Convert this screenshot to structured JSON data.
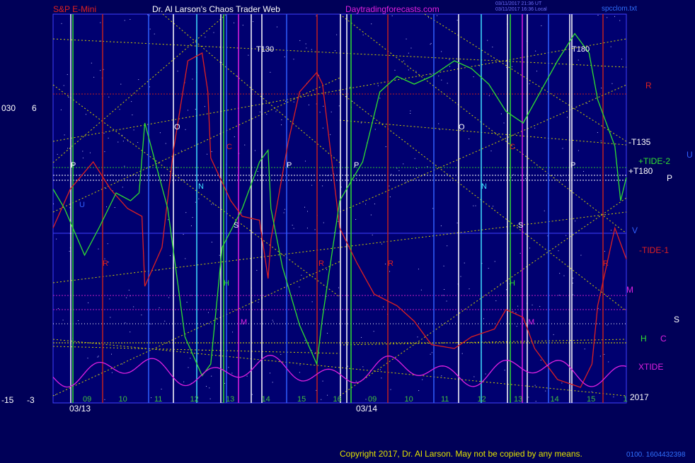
{
  "header": {
    "instrument": "S&P E-Mini",
    "author": "Dr. Al Larson's Chaos Trader Web",
    "site": "Daytradingforecasts.com",
    "timestamp_line1": "03/11/2017 21:36 UT",
    "timestamp_line2": "03/11/2017 16:36 Local",
    "file": "spcclom.txt"
  },
  "footer": {
    "copyright": "Copyright 2017, Dr. Al Larson. May not be copied by any means.",
    "code": "0100. 1604432398"
  },
  "left_axis": {
    "top": [
      "030",
      "6"
    ],
    "bottom": [
      "-15",
      "-3"
    ]
  },
  "right_labels": [
    {
      "text": "R",
      "color": "#e02020"
    },
    {
      "text": "-T135",
      "color": "#ffffff"
    },
    {
      "text": "+TIDE-2",
      "color": "#30e030"
    },
    {
      "text": "U",
      "color": "#3060ff"
    },
    {
      "text": "+T180",
      "color": "#ffffff"
    },
    {
      "text": "P",
      "color": "#ffffff"
    },
    {
      "text": "V",
      "color": "#3060ff"
    },
    {
      "text": "-TIDE-1",
      "color": "#e02020"
    },
    {
      "text": "M",
      "color": "#e020e0"
    },
    {
      "text": "S",
      "color": "#ffffff"
    },
    {
      "text": "H",
      "color": "#30e030"
    },
    {
      "text": "C",
      "color": "#e020e0"
    },
    {
      "text": "XTIDE",
      "color": "#e020e0"
    },
    {
      "text": "2017",
      "color": "#ffffff"
    }
  ],
  "chart_data": {
    "type": "line",
    "dates": [
      "03/13",
      "03/14"
    ],
    "x_ticks": [
      [
        "09",
        "10",
        "11",
        "12",
        "13",
        "14",
        "15",
        "16"
      ],
      [
        "09",
        "10",
        "11",
        "12",
        "13",
        "14",
        "15",
        "1"
      ]
    ],
    "series": [
      {
        "name": "TIDE-1",
        "color": "#e02020"
      },
      {
        "name": "TIDE-2",
        "color": "#30e030"
      },
      {
        "name": "XTIDE",
        "color": "#e020e0"
      }
    ],
    "series_values": {
      "red": [
        [
          0,
          0.55
        ],
        [
          0.03,
          0.45
        ],
        [
          0.07,
          0.38
        ],
        [
          0.1,
          0.45
        ],
        [
          0.13,
          0.5
        ],
        [
          0.155,
          0.52
        ],
        [
          0.16,
          0.7
        ],
        [
          0.19,
          0.6
        ],
        [
          0.21,
          0.35
        ],
        [
          0.235,
          0.12
        ],
        [
          0.26,
          0.1
        ],
        [
          0.27,
          0.2
        ],
        [
          0.275,
          0.37
        ],
        [
          0.31,
          0.48
        ],
        [
          0.33,
          0.52
        ],
        [
          0.36,
          0.53
        ],
        [
          0.375,
          0.68
        ],
        [
          0.38,
          0.58
        ],
        [
          0.41,
          0.33
        ],
        [
          0.43,
          0.2
        ],
        [
          0.46,
          0.15
        ],
        [
          0.47,
          0.18
        ],
        [
          0.5,
          0.55
        ],
        [
          0.53,
          0.64
        ],
        [
          0.56,
          0.72
        ],
        [
          0.6,
          0.75
        ],
        [
          0.63,
          0.79
        ],
        [
          0.66,
          0.85
        ],
        [
          0.7,
          0.86
        ],
        [
          0.73,
          0.83
        ],
        [
          0.77,
          0.81
        ],
        [
          0.79,
          0.76
        ],
        [
          0.82,
          0.78
        ],
        [
          0.84,
          0.86
        ],
        [
          0.88,
          0.94
        ],
        [
          0.92,
          0.96
        ],
        [
          0.94,
          0.9
        ],
        [
          0.95,
          0.75
        ],
        [
          0.98,
          0.55
        ],
        [
          1,
          0.63
        ]
      ],
      "green": [
        [
          0,
          0.45
        ],
        [
          0.02,
          0.5
        ],
        [
          0.055,
          0.62
        ],
        [
          0.08,
          0.55
        ],
        [
          0.11,
          0.46
        ],
        [
          0.135,
          0.48
        ],
        [
          0.15,
          0.46
        ],
        [
          0.16,
          0.28
        ],
        [
          0.2,
          0.5
        ],
        [
          0.23,
          0.83
        ],
        [
          0.26,
          0.93
        ],
        [
          0.275,
          0.9
        ],
        [
          0.295,
          0.6
        ],
        [
          0.33,
          0.5
        ],
        [
          0.36,
          0.38
        ],
        [
          0.375,
          0.35
        ],
        [
          0.38,
          0.5
        ],
        [
          0.4,
          0.65
        ],
        [
          0.43,
          0.8
        ],
        [
          0.46,
          0.9
        ],
        [
          0.47,
          0.78
        ],
        [
          0.5,
          0.48
        ],
        [
          0.54,
          0.38
        ],
        [
          0.57,
          0.2
        ],
        [
          0.6,
          0.16
        ],
        [
          0.63,
          0.18
        ],
        [
          0.66,
          0.16
        ],
        [
          0.68,
          0.14
        ],
        [
          0.7,
          0.12
        ],
        [
          0.73,
          0.14
        ],
        [
          0.76,
          0.18
        ],
        [
          0.79,
          0.25
        ],
        [
          0.82,
          0.28
        ],
        [
          0.85,
          0.2
        ],
        [
          0.88,
          0.12
        ],
        [
          0.91,
          0.05
        ],
        [
          0.935,
          0.1
        ],
        [
          0.95,
          0.22
        ],
        [
          0.98,
          0.34
        ],
        [
          0.99,
          0.48
        ],
        [
          1,
          0.42
        ]
      ],
      "magenta_baseline": 0.5,
      "magenta_amp": 0.35
    }
  }
}
